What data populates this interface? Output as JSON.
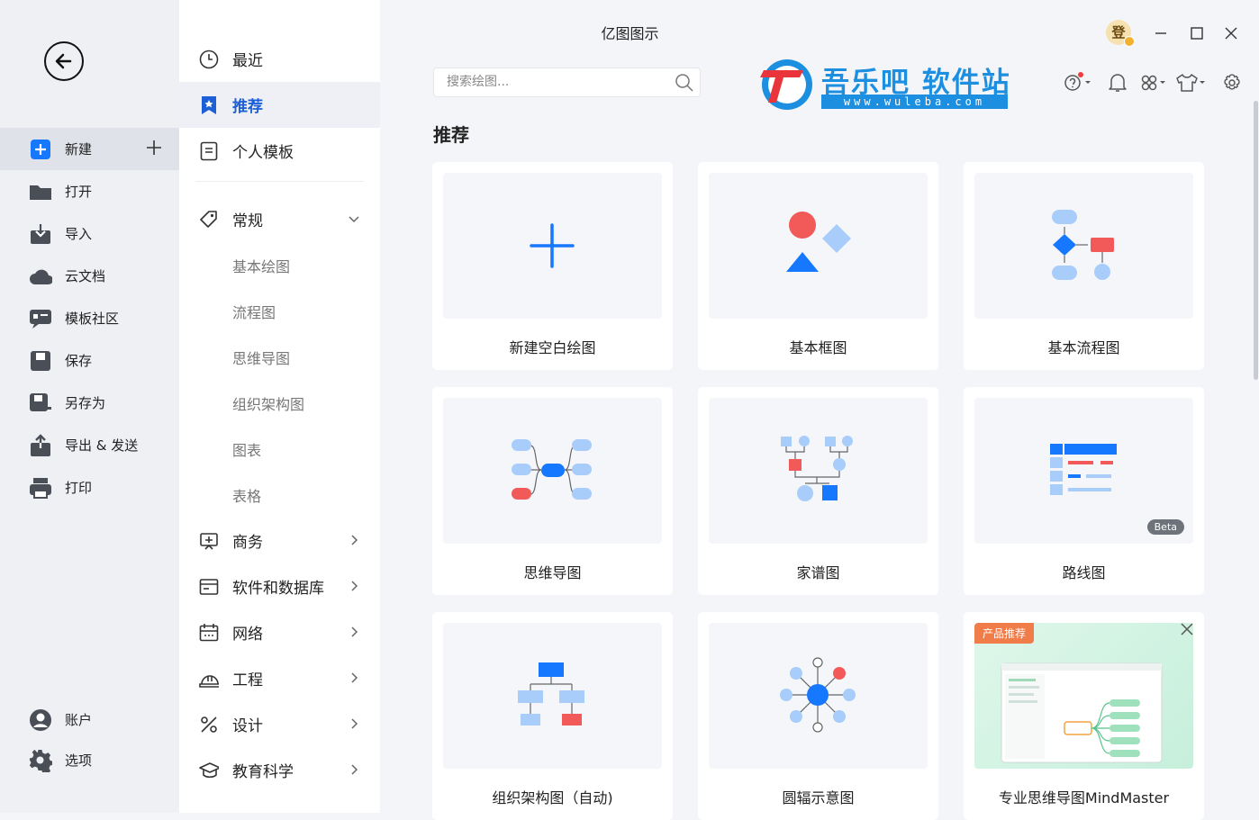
{
  "app": {
    "title": "亿图图示"
  },
  "left_nav": {
    "items": [
      {
        "label": "新建",
        "icon": "new-plus-icon"
      },
      {
        "label": "打开",
        "icon": "folder-icon"
      },
      {
        "label": "导入",
        "icon": "import-icon"
      },
      {
        "label": "云文档",
        "icon": "cloud-icon"
      },
      {
        "label": "模板社区",
        "icon": "community-icon"
      },
      {
        "label": "保存",
        "icon": "save-icon"
      },
      {
        "label": "另存为",
        "icon": "save-as-icon"
      },
      {
        "label": "导出 & 发送",
        "icon": "export-icon"
      },
      {
        "label": "打印",
        "icon": "print-icon"
      }
    ],
    "bottom": [
      {
        "label": "账户",
        "icon": "account-icon"
      },
      {
        "label": "选项",
        "icon": "gear-icon"
      }
    ]
  },
  "mid_nav": {
    "top": [
      {
        "label": "最近",
        "icon": "clock-icon"
      },
      {
        "label": "推荐",
        "icon": "bookmark-icon"
      },
      {
        "label": "个人模板",
        "icon": "template-icon"
      }
    ],
    "general": {
      "label": "常规",
      "icon": "tag-icon"
    },
    "sub": [
      "基本绘图",
      "流程图",
      "思维导图",
      "组织架构图",
      "图表",
      "表格"
    ],
    "categories": [
      {
        "label": "商务",
        "icon": "business-icon"
      },
      {
        "label": "软件和数据库",
        "icon": "software-icon"
      },
      {
        "label": "网络",
        "icon": "network-icon"
      },
      {
        "label": "工程",
        "icon": "engineering-icon"
      },
      {
        "label": "设计",
        "icon": "design-icon"
      },
      {
        "label": "教育科学",
        "icon": "education-icon"
      }
    ]
  },
  "search": {
    "placeholder": "搜索绘图..."
  },
  "logo": {
    "text": "吾乐吧 软件站",
    "url": "www.wuleba.com"
  },
  "avatar": {
    "text": "登"
  },
  "main": {
    "section_title": "推荐",
    "cards": [
      {
        "label": "新建空白绘图"
      },
      {
        "label": "基本框图"
      },
      {
        "label": "基本流程图"
      },
      {
        "label": "思维导图"
      },
      {
        "label": "家谱图"
      },
      {
        "label": "路线图",
        "badge": "Beta"
      },
      {
        "label": "组织架构图（自动)"
      },
      {
        "label": "圆辐示意图"
      },
      {
        "label": "专业思维导图MindMaster",
        "tag": "产品推荐"
      }
    ]
  },
  "colors": {
    "accent": "#1677ff",
    "red": "#f25a5a",
    "light_blue": "#a8cdfa"
  }
}
